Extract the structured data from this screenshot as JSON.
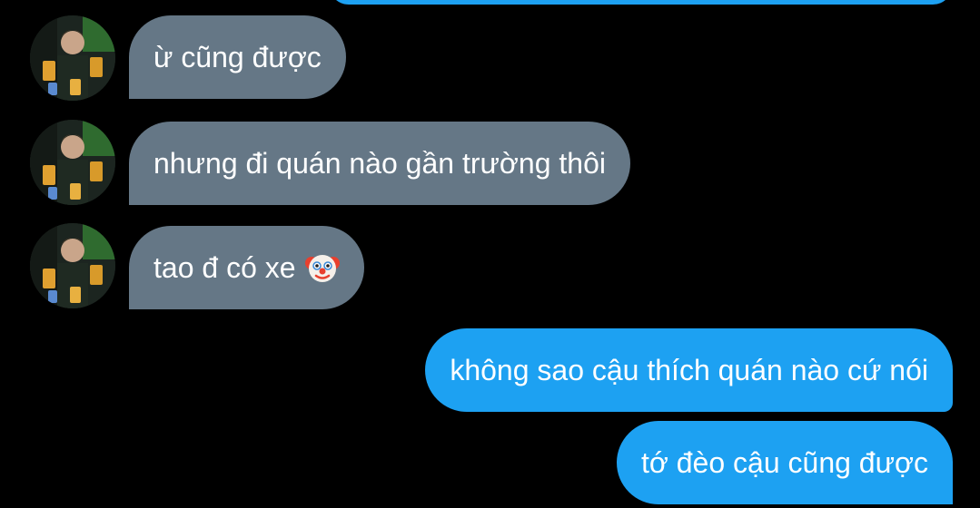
{
  "conversation": {
    "messages": [
      {
        "sender": "other",
        "text": "ừ cũng được",
        "avatar": "user-avatar"
      },
      {
        "sender": "other",
        "text": "nhưng đi quán nào gần trường thôi",
        "avatar": "user-avatar"
      },
      {
        "sender": "other",
        "text": "tao đ có xe",
        "emoji": "clown-face-emoji",
        "avatar": "user-avatar"
      },
      {
        "sender": "me",
        "text": "không sao cậu thích quán nào cứ nói"
      },
      {
        "sender": "me",
        "text": "tớ đèo cậu cũng được"
      }
    ]
  },
  "colors": {
    "background": "#000000",
    "incoming_bubble": "#657786",
    "outgoing_bubble": "#1da1f2",
    "text": "#ffffff"
  }
}
